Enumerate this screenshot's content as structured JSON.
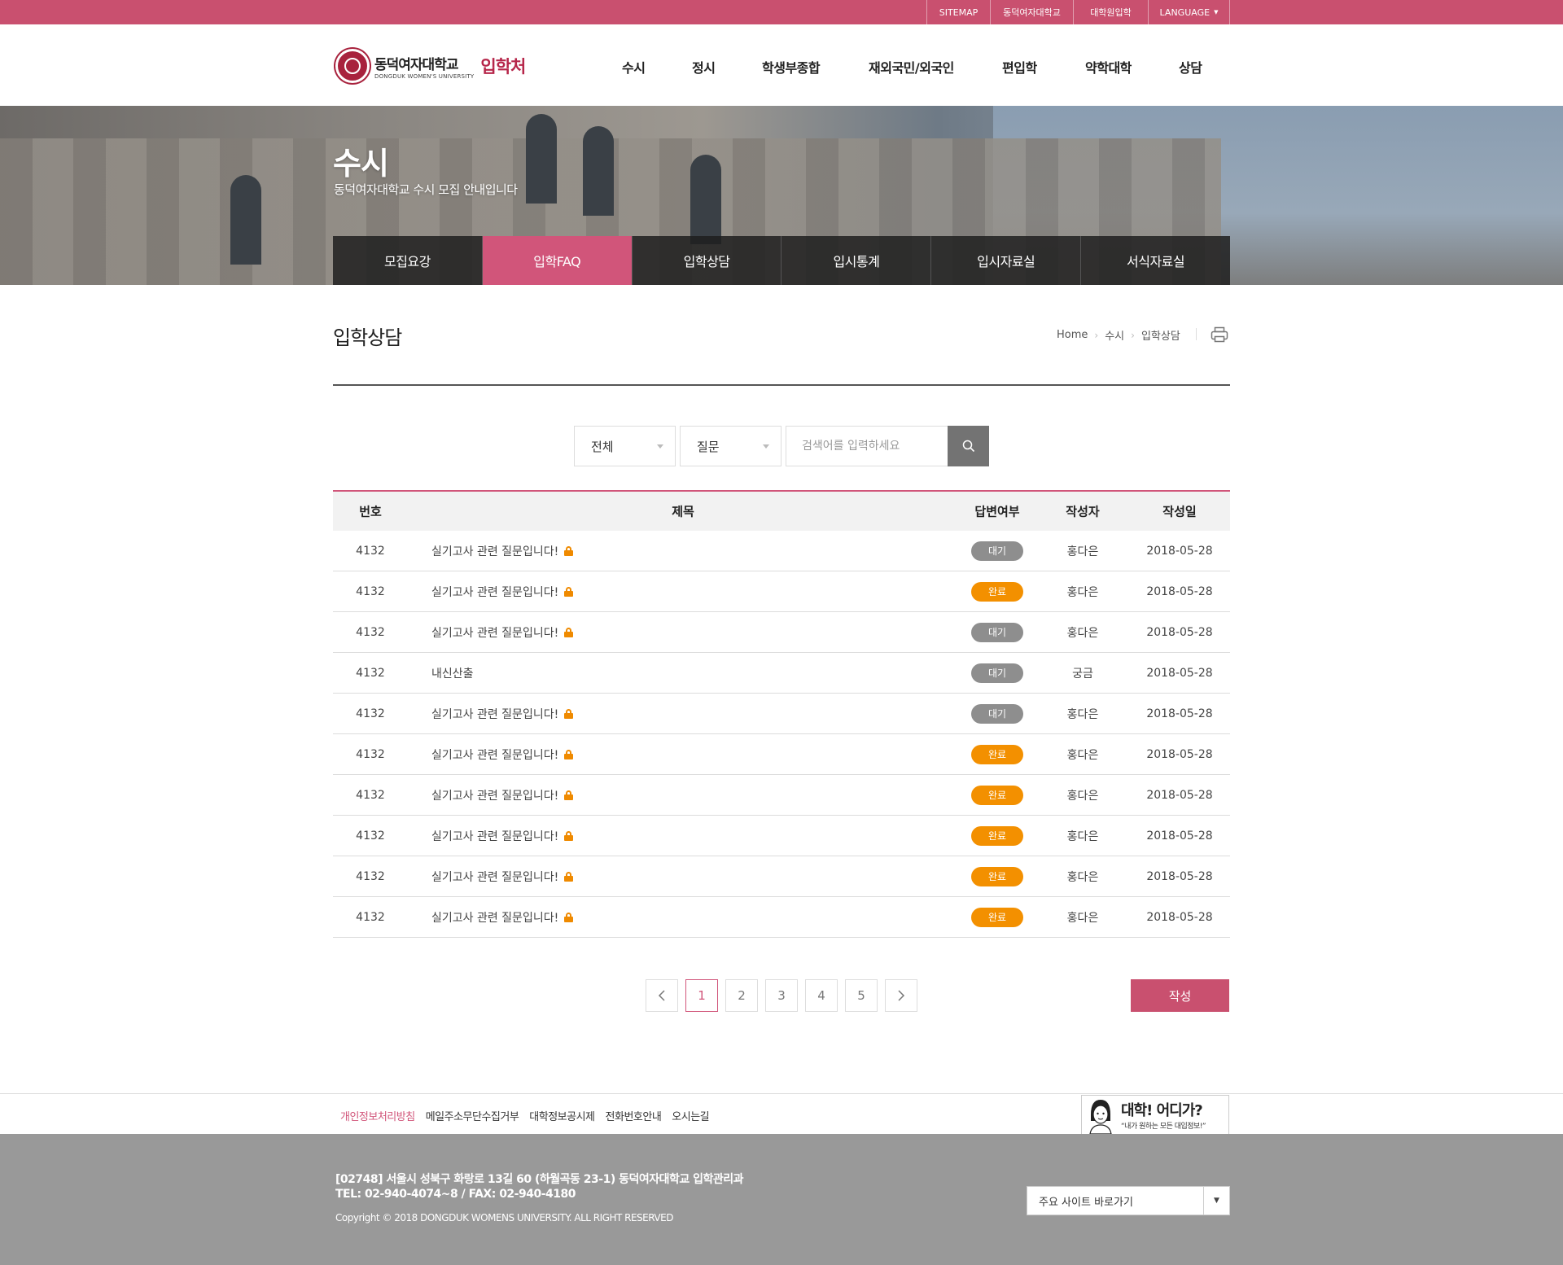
{
  "topbar": {
    "links": [
      "SITEMAP",
      "동덕여자대학교",
      "대학원입학",
      "LANGUAGE"
    ],
    "language_caret": "▼"
  },
  "header": {
    "logo_name": "동덕여자대학교",
    "logo_en": "DONGDUK WOMEN'S UNIVERSITY",
    "logo_suffix": "입학처",
    "nav": [
      "수시",
      "정시",
      "학생부종합",
      "재외국민/외국인",
      "편입학",
      "약학대학",
      "상담"
    ]
  },
  "hero": {
    "title": "수시",
    "subtitle": "동덕여자대학교 수시 모집 안내입니다",
    "tabs": [
      "모집요강",
      "입학FAQ",
      "입학상담",
      "입시통계",
      "입시자료실",
      "서식자료실"
    ],
    "active_tab": 1
  },
  "page": {
    "title": "입학상담",
    "breadcrumb": [
      "Home",
      "수시",
      "입학상담"
    ]
  },
  "search": {
    "category": "전체",
    "field": "질문",
    "placeholder": "검색어를 입력하세요"
  },
  "table": {
    "headers": [
      "번호",
      "제목",
      "답변여부",
      "작성자",
      "작성일"
    ],
    "rows": [
      {
        "no": "4132",
        "title": "실기고사 관련 질문입니다!",
        "locked": true,
        "status": "대기",
        "status_type": "wait",
        "author": "홍다은",
        "date": "2018-05-28"
      },
      {
        "no": "4132",
        "title": "실기고사 관련 질문입니다!",
        "locked": true,
        "status": "완료",
        "status_type": "done",
        "author": "홍다은",
        "date": "2018-05-28"
      },
      {
        "no": "4132",
        "title": "실기고사 관련 질문입니다!",
        "locked": true,
        "status": "대기",
        "status_type": "wait",
        "author": "홍다은",
        "date": "2018-05-28"
      },
      {
        "no": "4132",
        "title": "내신산출",
        "locked": false,
        "status": "대기",
        "status_type": "wait",
        "author": "궁금",
        "date": "2018-05-28"
      },
      {
        "no": "4132",
        "title": "실기고사 관련 질문입니다!",
        "locked": true,
        "status": "대기",
        "status_type": "wait",
        "author": "홍다은",
        "date": "2018-05-28"
      },
      {
        "no": "4132",
        "title": "실기고사 관련 질문입니다!",
        "locked": true,
        "status": "완료",
        "status_type": "done",
        "author": "홍다은",
        "date": "2018-05-28"
      },
      {
        "no": "4132",
        "title": "실기고사 관련 질문입니다!",
        "locked": true,
        "status": "완료",
        "status_type": "done",
        "author": "홍다은",
        "date": "2018-05-28"
      },
      {
        "no": "4132",
        "title": "실기고사 관련 질문입니다!",
        "locked": true,
        "status": "완료",
        "status_type": "done",
        "author": "홍다은",
        "date": "2018-05-28"
      },
      {
        "no": "4132",
        "title": "실기고사 관련 질문입니다!",
        "locked": true,
        "status": "완료",
        "status_type": "done",
        "author": "홍다은",
        "date": "2018-05-28"
      },
      {
        "no": "4132",
        "title": "실기고사 관련 질문입니다!",
        "locked": true,
        "status": "완료",
        "status_type": "done",
        "author": "홍다은",
        "date": "2018-05-28"
      }
    ]
  },
  "pagination": {
    "pages": [
      "1",
      "2",
      "3",
      "4",
      "5"
    ],
    "current": "1"
  },
  "write_label": "작성",
  "footer": {
    "links": [
      "개인정보처리방침",
      "메일주소무단수집거부",
      "대학정보공시제",
      "전화번호안내",
      "오시는길"
    ],
    "banner_title": "대학! 어디가?",
    "banner_sub": "“내가 원하는 모든 대입정보!”",
    "address": "[02748] 서울시 성북구 화랑로 13길 60 (하월곡동 23-1) 동덕여자대학교 입학관리과",
    "tel": "TEL: 02-940-4074~8 / FAX: 02-940-4180",
    "copyright": "Copyright © 2018 DONGDUK WOMENS UNIVERSITY. ALL RIGHT RESERVED",
    "site_select": "주요 사이트 바로가기",
    "site_select_caret": "▼"
  },
  "colors": {
    "brand": "#c9506f",
    "active_tab": "#d1557a",
    "status_done": "#f39000",
    "status_wait": "#8e8e8e",
    "footer_bg": "#999999"
  }
}
